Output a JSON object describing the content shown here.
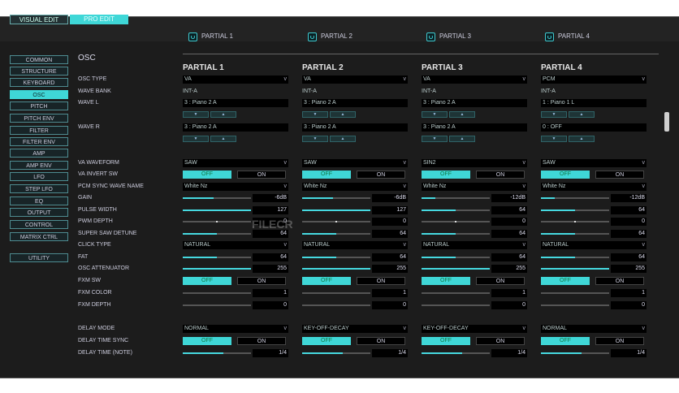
{
  "modes": {
    "visual": "VISUAL EDIT",
    "pro": "PRO EDIT"
  },
  "partial_tabs": [
    "PARTIAL 1",
    "PARTIAL 2",
    "PARTIAL 3",
    "PARTIAL 4"
  ],
  "sidebar": [
    "COMMON",
    "STRUCTURE",
    "KEYBOARD",
    "OSC",
    "PITCH",
    "PITCH ENV",
    "FILTER",
    "FILTER ENV",
    "AMP",
    "AMP ENV",
    "LFO",
    "STEP LFO",
    "EQ",
    "OUTPUT",
    "CONTROL",
    "MATRIX CTRL",
    "UTILITY"
  ],
  "sidebar_selected": "OSC",
  "section_title": "OSC",
  "partial_headers": [
    "PARTIAL 1",
    "PARTIAL 2",
    "PARTIAL 3",
    "PARTIAL 4"
  ],
  "labels": {
    "osc_type": "OSC TYPE",
    "wave_bank": "WAVE BANK",
    "wave_l": "WAVE L",
    "wave_r": "WAVE R",
    "va_waveform": "VA WAVEFORM",
    "va_invert_sw": "VA INVERT SW",
    "pcm_sync_wave_name": "PCM SYNC WAVE NAME",
    "gain": "GAIN",
    "pulse_width": "PULSE WIDTH",
    "pwm_depth": "PWM DEPTH",
    "super_saw_detune": "SUPER SAW DETUNE",
    "click_type": "CLICK TYPE",
    "fat": "FAT",
    "osc_attenuator": "OSC ATTENUATOR",
    "fxm_sw": "FXM SW",
    "fxm_color": "FXM COLOR",
    "fxm_depth": "FXM DEPTH",
    "delay_mode": "DELAY MODE",
    "delay_time_sync": "DELAY TIME SYNC",
    "delay_time_note": "DELAY TIME (NOTE)"
  },
  "toggle_labels": {
    "off": "OFF",
    "on": "ON"
  },
  "arrows": {
    "down": "▼",
    "up": "▲"
  },
  "chevron": "v",
  "watermark": "FILECR",
  "partials": [
    {
      "osc_type": "VA",
      "wave_bank": "INT-A",
      "wave_l": "3 : Piano 2 A",
      "wave_r": "3 : Piano 2 A",
      "va_waveform": "SAW",
      "va_invert": "OFF",
      "pcm_sync": "White Nz",
      "gain": {
        "text": "-6dB",
        "level": 0.45
      },
      "pulse_width": {
        "text": "127",
        "level": 1.0
      },
      "pwm_depth": {
        "text": "0",
        "level": 0.5
      },
      "super_saw_detune": {
        "text": "64",
        "level": 0.5
      },
      "click_type": "NATURAL",
      "fat": {
        "text": "64",
        "level": 0.5
      },
      "osc_attenuator": {
        "text": "255",
        "level": 1.0
      },
      "fxm_sw": "OFF",
      "fxm_color": {
        "text": "1",
        "level": 0.0
      },
      "fxm_depth": {
        "text": "0",
        "level": 0.0
      },
      "delay_mode": "NORMAL",
      "delay_sync": "OFF",
      "delay_time": {
        "text": "1/4",
        "level": 0.6
      }
    },
    {
      "osc_type": "VA",
      "wave_bank": "INT-A",
      "wave_l": "3 : Piano 2 A",
      "wave_r": "3 : Piano 2 A",
      "va_waveform": "SAW",
      "va_invert": "OFF",
      "pcm_sync": "White Nz",
      "gain": {
        "text": "-6dB",
        "level": 0.45
      },
      "pulse_width": {
        "text": "127",
        "level": 1.0
      },
      "pwm_depth": {
        "text": "0",
        "level": 0.5
      },
      "super_saw_detune": {
        "text": "64",
        "level": 0.5
      },
      "click_type": "NATURAL",
      "fat": {
        "text": "64",
        "level": 0.5
      },
      "osc_attenuator": {
        "text": "255",
        "level": 1.0
      },
      "fxm_sw": "OFF",
      "fxm_color": {
        "text": "1",
        "level": 0.0
      },
      "fxm_depth": {
        "text": "0",
        "level": 0.0
      },
      "delay_mode": "KEY-OFF-DECAY",
      "delay_sync": "OFF",
      "delay_time": {
        "text": "1/4",
        "level": 0.6
      }
    },
    {
      "osc_type": "VA",
      "wave_bank": "INT-A",
      "wave_l": "3 : Piano 2 A",
      "wave_r": "3 : Piano 2 A",
      "va_waveform": "SIN2",
      "va_invert": "OFF",
      "pcm_sync": "White Nz",
      "gain": {
        "text": "-12dB",
        "level": 0.2
      },
      "pulse_width": {
        "text": "64",
        "level": 0.5
      },
      "pwm_depth": {
        "text": "0",
        "level": 0.5
      },
      "super_saw_detune": {
        "text": "64",
        "level": 0.5
      },
      "click_type": "NATURAL",
      "fat": {
        "text": "64",
        "level": 0.5
      },
      "osc_attenuator": {
        "text": "255",
        "level": 1.0
      },
      "fxm_sw": "OFF",
      "fxm_color": {
        "text": "1",
        "level": 0.0
      },
      "fxm_depth": {
        "text": "0",
        "level": 0.0
      },
      "delay_mode": "KEY-OFF-DECAY",
      "delay_sync": "OFF",
      "delay_time": {
        "text": "1/4",
        "level": 0.6
      }
    },
    {
      "osc_type": "PCM",
      "wave_bank": "INT-A",
      "wave_l": "1 : Piano 1 L",
      "wave_r": "0 : OFF",
      "va_waveform": "SAW",
      "va_invert": "OFF",
      "pcm_sync": "White Nz",
      "gain": {
        "text": "-12dB",
        "level": 0.2
      },
      "pulse_width": {
        "text": "64",
        "level": 0.5
      },
      "pwm_depth": {
        "text": "0",
        "level": 0.5
      },
      "super_saw_detune": {
        "text": "64",
        "level": 0.5
      },
      "click_type": "NATURAL",
      "fat": {
        "text": "64",
        "level": 0.5
      },
      "osc_attenuator": {
        "text": "255",
        "level": 1.0
      },
      "fxm_sw": "OFF",
      "fxm_color": {
        "text": "1",
        "level": 0.0
      },
      "fxm_depth": {
        "text": "0",
        "level": 0.0
      },
      "delay_mode": "NORMAL",
      "delay_sync": "OFF",
      "delay_time": {
        "text": "1/4",
        "level": 0.6
      }
    }
  ]
}
